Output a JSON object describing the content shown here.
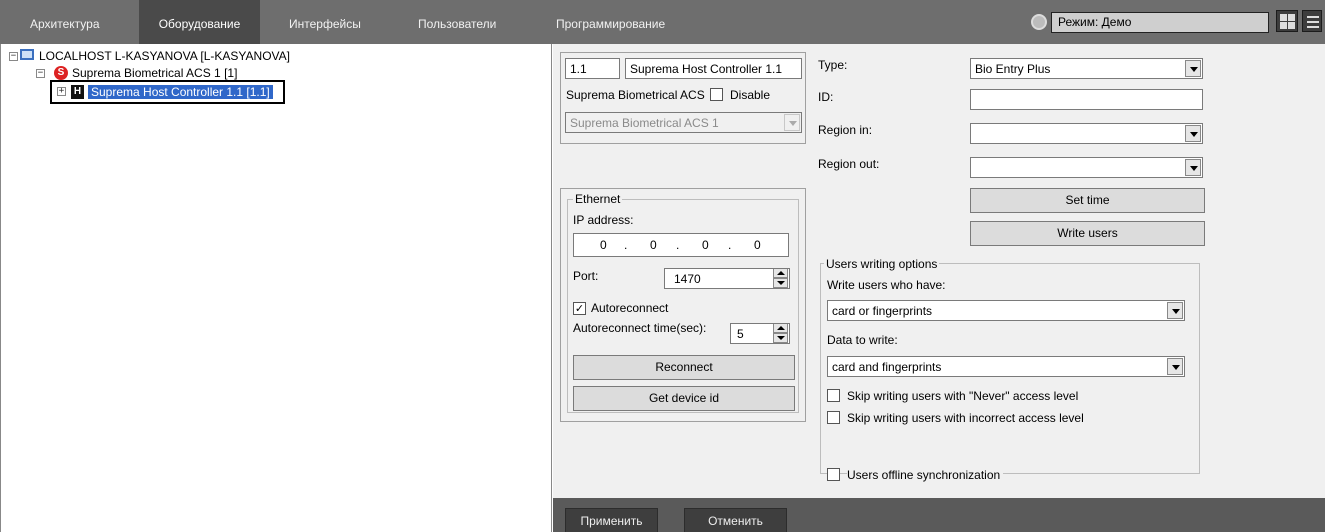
{
  "topbar": {
    "tabs": [
      "Архитектура",
      "Оборудование",
      "Интерфейсы",
      "Пользователи",
      "Программирование"
    ],
    "active_tab": "Оборудование",
    "mode_label": "Режим: Демо"
  },
  "tree": {
    "root_label": "LOCALHOST L-KASYANOVA [L-KASYANOVA]",
    "acs_label": "Suprema Biometrical ACS 1 [1]",
    "controller_label": "Suprema Host Controller 1.1 [1.1]"
  },
  "device": {
    "id_value": "1.1",
    "name_value": "Suprema Host Controller 1.1",
    "parent_label": "Suprema Biometrical ACS",
    "disable_label": "Disable",
    "disable_checked": false,
    "parent_select": "Suprema Biometrical ACS 1"
  },
  "ethernet": {
    "legend": "Ethernet",
    "ip_label": "IP address:",
    "ip_octets": [
      "0",
      "0",
      "0",
      "0"
    ],
    "ip_dot": ".",
    "port_label": "Port:",
    "port_value": "1470",
    "autoreconnect_label": "Autoreconnect",
    "autoreconnect_checked": true,
    "autoreconnect_time_label": "Autoreconnect time(sec):",
    "autoreconnect_time_value": "5",
    "reconnect_button": "Reconnect",
    "get_device_id_button": "Get device id"
  },
  "settings": {
    "type_label": "Type:",
    "type_value": "Bio Entry Plus",
    "id_label": "ID:",
    "id_value": "",
    "region_in_label": "Region in:",
    "region_in_value": "",
    "region_out_label": "Region out:",
    "region_out_value": "",
    "set_time_button": "Set time",
    "write_users_button": "Write users"
  },
  "users_writing": {
    "legend": "Users writing options",
    "write_who_label": "Write users who have:",
    "write_who_value": "card or fingerprints",
    "data_to_write_label": "Data to write:",
    "data_to_write_value": "card and fingerprints",
    "skip_never_label": "Skip writing users with \"Never\" access level",
    "skip_never_checked": false,
    "skip_incorrect_label": "Skip writing users with incorrect access level",
    "skip_incorrect_checked": false,
    "offline_sync_label": "Users offline synchronization",
    "offline_sync_checked": false
  },
  "bottombar": {
    "apply_button": "Применить",
    "cancel_button": "Отменить"
  },
  "colors": {
    "topbar_bg": "#6e6e6e",
    "active_tab_bg": "#4a4a4a",
    "selection_bg": "#2f67c9",
    "panel_bg": "#f0f0f0",
    "bottombar_bg": "#5a5a5a"
  },
  "icons": [
    "computer-icon",
    "suprema-s-icon",
    "host-controller-h-icon",
    "mode-gear-icon",
    "grid-view-icon",
    "menu-icon"
  ]
}
